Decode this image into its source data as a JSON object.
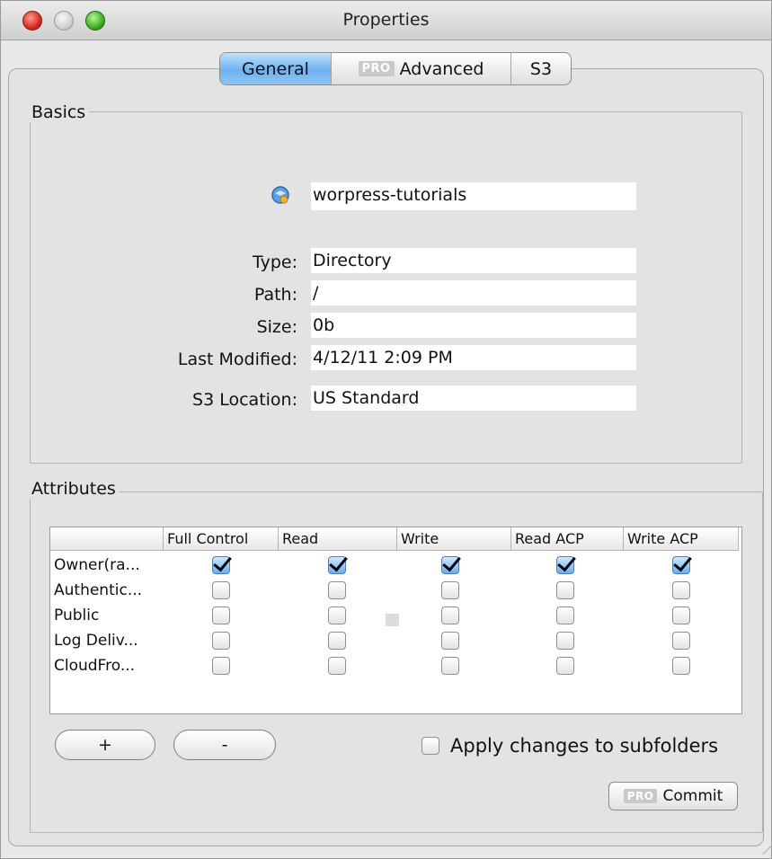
{
  "window": {
    "title": "Properties"
  },
  "tabs": [
    {
      "label": "General",
      "pro": "",
      "active": true
    },
    {
      "label": "Advanced",
      "pro": "PRO",
      "active": false
    },
    {
      "label": "S3",
      "pro": "",
      "active": false
    }
  ],
  "basics": {
    "legend": "Basics",
    "icon": "bucket-icon",
    "name": "worpress-tutorials",
    "fields": [
      {
        "label": "Type:",
        "value": "Directory"
      },
      {
        "label": "Path:",
        "value": "/"
      },
      {
        "label": "Size:",
        "value": "0b"
      },
      {
        "label": "Last Modified:",
        "value": "4/12/11 2:09 PM"
      },
      {
        "label": "S3 Location:",
        "value": "US Standard"
      }
    ]
  },
  "attributes": {
    "legend": "Attributes",
    "columns": [
      "",
      "Full Control",
      "Read",
      "Write",
      "Read ACP",
      "Write ACP"
    ],
    "rows": [
      {
        "name": "Owner(ra...",
        "checks": [
          true,
          true,
          true,
          true,
          true
        ]
      },
      {
        "name": "Authentic...",
        "checks": [
          false,
          false,
          false,
          false,
          false
        ]
      },
      {
        "name": "Public",
        "checks": [
          false,
          false,
          false,
          false,
          false
        ]
      },
      {
        "name": "Log Deliv...",
        "checks": [
          false,
          false,
          false,
          false,
          false
        ]
      },
      {
        "name": "CloudFro...",
        "checks": [
          false,
          false,
          false,
          false,
          false
        ]
      }
    ],
    "add_label": "+",
    "remove_label": "-",
    "apply_label": "Apply changes to subfolders",
    "apply_checked": false,
    "commit_pro": "PRO",
    "commit_label": "Commit"
  },
  "colors": {
    "tab_active": "#6fb2ef",
    "checkbox_checked": "#6aaef0"
  }
}
